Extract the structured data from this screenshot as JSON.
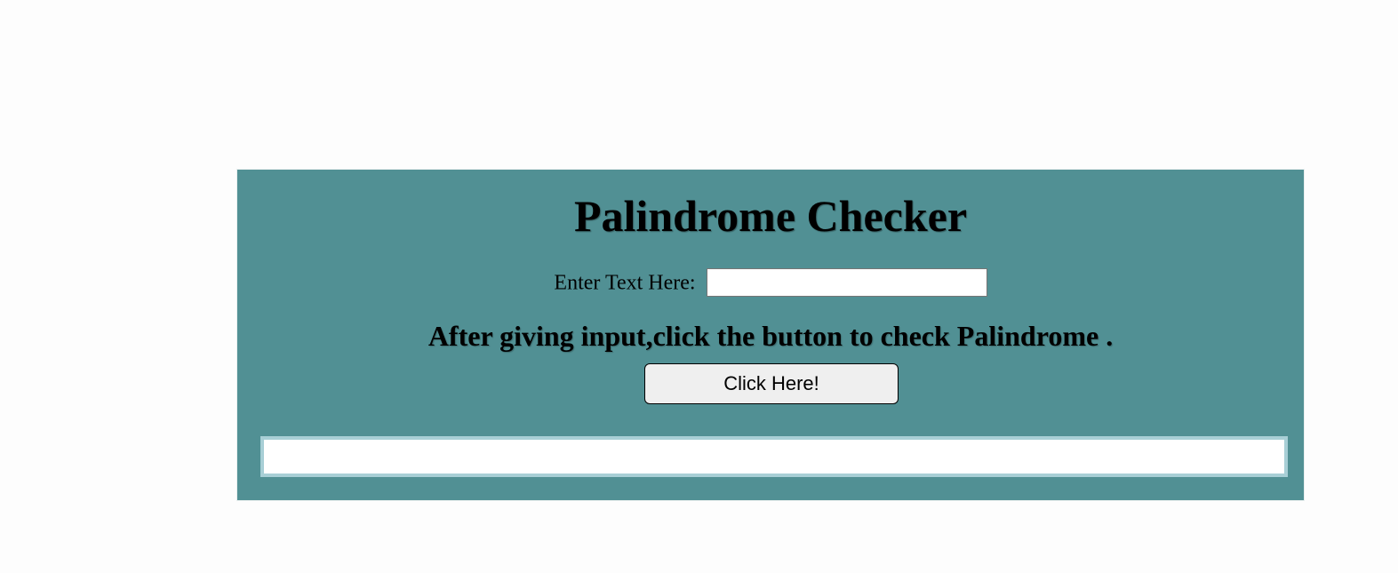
{
  "app": {
    "title": "Palindrome Checker"
  },
  "form": {
    "input_label": "Enter Text Here:",
    "input_value": "",
    "input_placeholder": ""
  },
  "instruction": "After giving input,click the button to check Palindrome .",
  "button": {
    "label": "Click Here!"
  },
  "result": {
    "text": ""
  },
  "colors": {
    "panel_background": "#519094",
    "result_border": "#a8cfd6",
    "button_background": "#efefef"
  }
}
